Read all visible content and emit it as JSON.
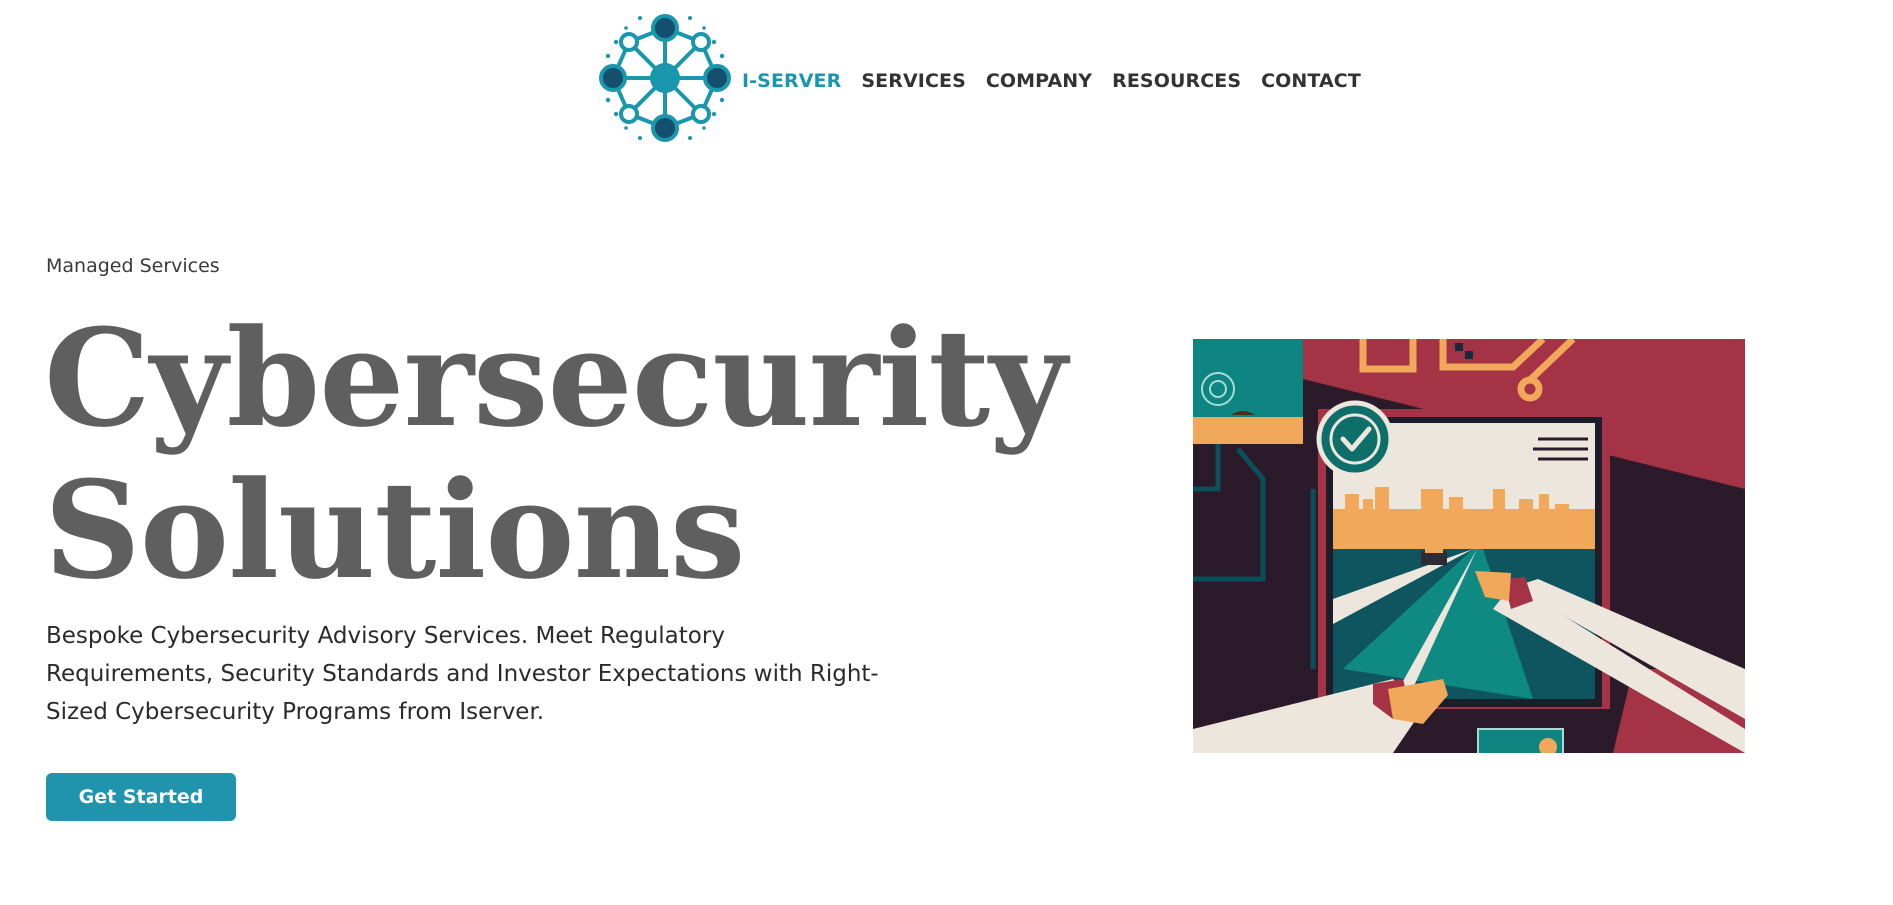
{
  "header": {
    "logo_icon": "network-hub-logo-icon",
    "nav": [
      {
        "label": "I-SERVER",
        "active": true
      },
      {
        "label": "SERVICES",
        "active": false
      },
      {
        "label": "COMPANY",
        "active": false
      },
      {
        "label": "RESOURCES",
        "active": false
      },
      {
        "label": "CONTACT",
        "active": false
      }
    ]
  },
  "hero": {
    "eyebrow": "Managed Services",
    "headline_line1": "Cybersecurity",
    "headline_line2": "Solutions",
    "intro": "Bespoke Cybersecurity Advisory Services. Meet Regulatory Requirements, Security Standards and Investor Expectations with Right-Sized Cybersecurity Programs from Iserver.",
    "cta_label": "Get Started",
    "illustration_icon": "secure-browsing-illustration"
  },
  "colors": {
    "brand_teal": "#1a96ad",
    "button": "#1f94ac",
    "headline": "#5f5f5f",
    "nav_text": "#333333"
  }
}
